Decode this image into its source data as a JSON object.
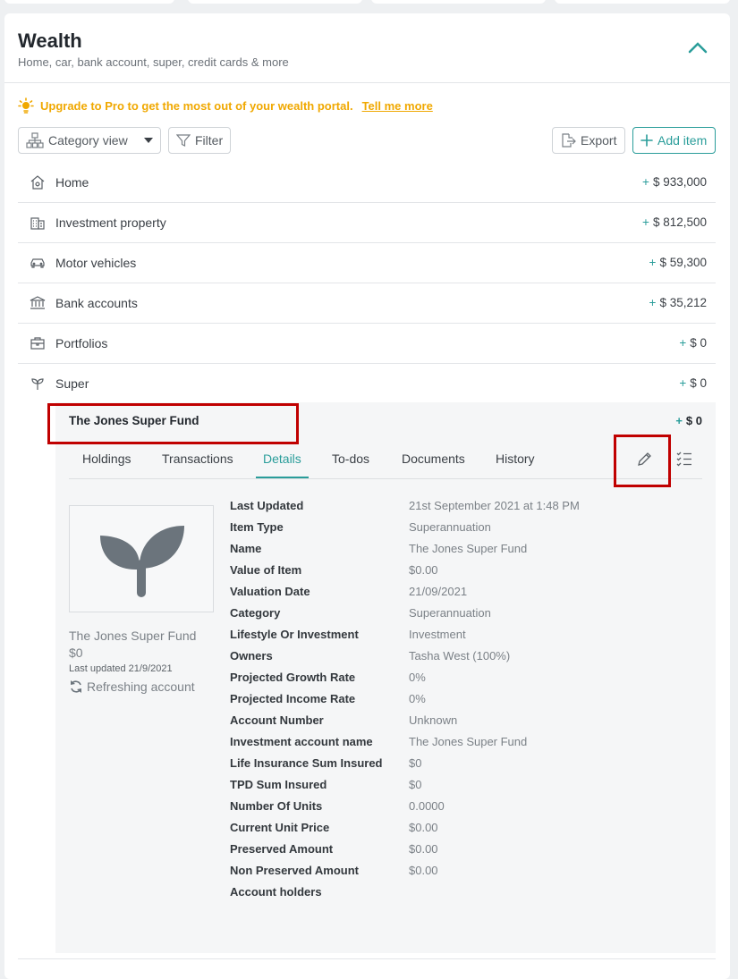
{
  "header": {
    "title": "Wealth",
    "subtitle": "Home, car, bank account, super, credit cards & more"
  },
  "upgrade": {
    "text": "Upgrade to Pro to get the most out of your wealth portal.",
    "link": "Tell me more"
  },
  "toolbar": {
    "category_view": "Category view",
    "filter": "Filter",
    "export": "Export",
    "add_item": "Add item"
  },
  "categories": [
    {
      "label": "Home",
      "sign": "+",
      "amount": "$ 933,000",
      "icon": "home-icon"
    },
    {
      "label": "Investment property",
      "sign": "+",
      "amount": "$ 812,500",
      "icon": "building-icon"
    },
    {
      "label": "Motor vehicles",
      "sign": "+",
      "amount": "$ 59,300",
      "icon": "car-icon"
    },
    {
      "label": "Bank accounts",
      "sign": "+",
      "amount": "$ 35,212",
      "icon": "bank-icon"
    },
    {
      "label": "Portfolios",
      "sign": "+",
      "amount": "$ 0",
      "icon": "briefcase-icon"
    },
    {
      "label": "Super",
      "sign": "+",
      "amount": "$ 0",
      "icon": "sprout-icon"
    }
  ],
  "fund": {
    "name": "The Jones Super Fund",
    "sign": "+",
    "amount": "$ 0"
  },
  "tabs": [
    "Holdings",
    "Transactions",
    "Details",
    "To-dos",
    "Documents",
    "History"
  ],
  "active_tab": "Details",
  "side": {
    "name": "The Jones Super Fund",
    "value": "$0",
    "last_updated": "Last updated 21/9/2021",
    "refreshing": "Refreshing account"
  },
  "details": [
    {
      "k": "Last Updated",
      "v": "21st September 2021 at 1:48 PM"
    },
    {
      "k": "Item Type",
      "v": "Superannuation"
    },
    {
      "k": "Name",
      "v": "The Jones Super Fund"
    },
    {
      "k": "Value of Item",
      "v": "$0.00"
    },
    {
      "k": "Valuation Date",
      "v": "21/09/2021"
    },
    {
      "k": "Category",
      "v": "Superannuation"
    },
    {
      "k": "Lifestyle Or Investment",
      "v": "Investment"
    },
    {
      "k": "Owners",
      "v": "Tasha West (100%)"
    },
    {
      "k": "Projected Growth Rate",
      "v": "0%"
    },
    {
      "k": "Projected Income Rate",
      "v": "0%"
    },
    {
      "k": "Account Number",
      "v": "Unknown"
    },
    {
      "k": "Investment account name",
      "v": "The Jones Super Fund"
    },
    {
      "k": "Life Insurance Sum Insured",
      "v": "$0"
    },
    {
      "k": "TPD Sum Insured",
      "v": "$0"
    },
    {
      "k": "Number Of Units",
      "v": "0.0000"
    },
    {
      "k": "Current Unit Price",
      "v": "$0.00"
    },
    {
      "k": "Preserved Amount",
      "v": "$0.00"
    },
    {
      "k": "Non Preserved Amount",
      "v": "$0.00"
    },
    {
      "k": "Account holders",
      "v": ""
    }
  ],
  "colors": {
    "accent": "#2a9d9a",
    "upgrade": "#f0a800",
    "highlight": "#c00000"
  }
}
